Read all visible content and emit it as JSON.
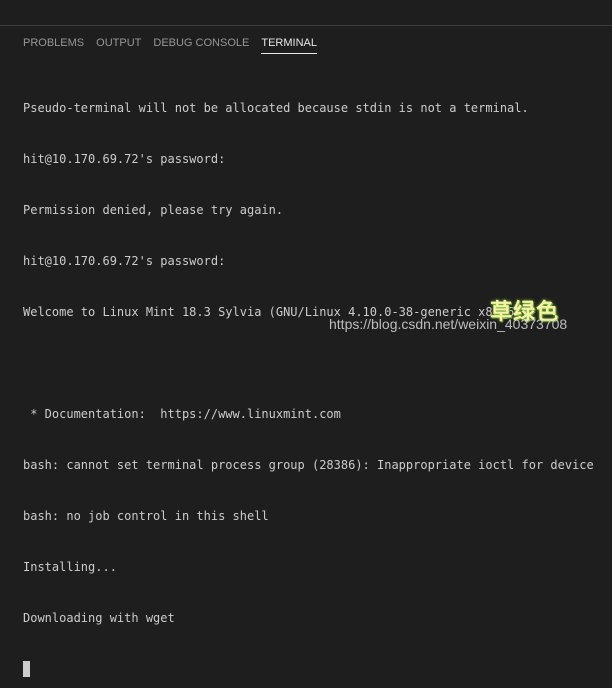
{
  "panel": {
    "tabs": [
      {
        "label": "PROBLEMS",
        "active": false
      },
      {
        "label": "OUTPUT",
        "active": false
      },
      {
        "label": "DEBUG CONSOLE",
        "active": false
      },
      {
        "label": "TERMINAL",
        "active": true
      }
    ]
  },
  "terminal": {
    "lines": [
      "Pseudo-terminal will not be allocated because stdin is not a terminal.",
      "hit@10.170.69.72's password:",
      "Permission denied, please try again.",
      "hit@10.170.69.72's password:",
      "Welcome to Linux Mint 18.3 Sylvia (GNU/Linux 4.10.0-38-generic x86_64)",
      "",
      " * Documentation:  https://www.linuxmint.com",
      "bash: cannot set terminal process group (28386): Inappropriate ioctl for device",
      "bash: no job control in this shell",
      "Installing...",
      "Downloading with wget"
    ]
  },
  "watermark": {
    "logo_text": "草绿色",
    "url": "https://blog.csdn.net/weixin_40373708"
  },
  "colors": {
    "background": "#1e1e1e",
    "text": "#cccccc",
    "tab_inactive": "#979797",
    "tab_active": "#e7e7e7"
  }
}
